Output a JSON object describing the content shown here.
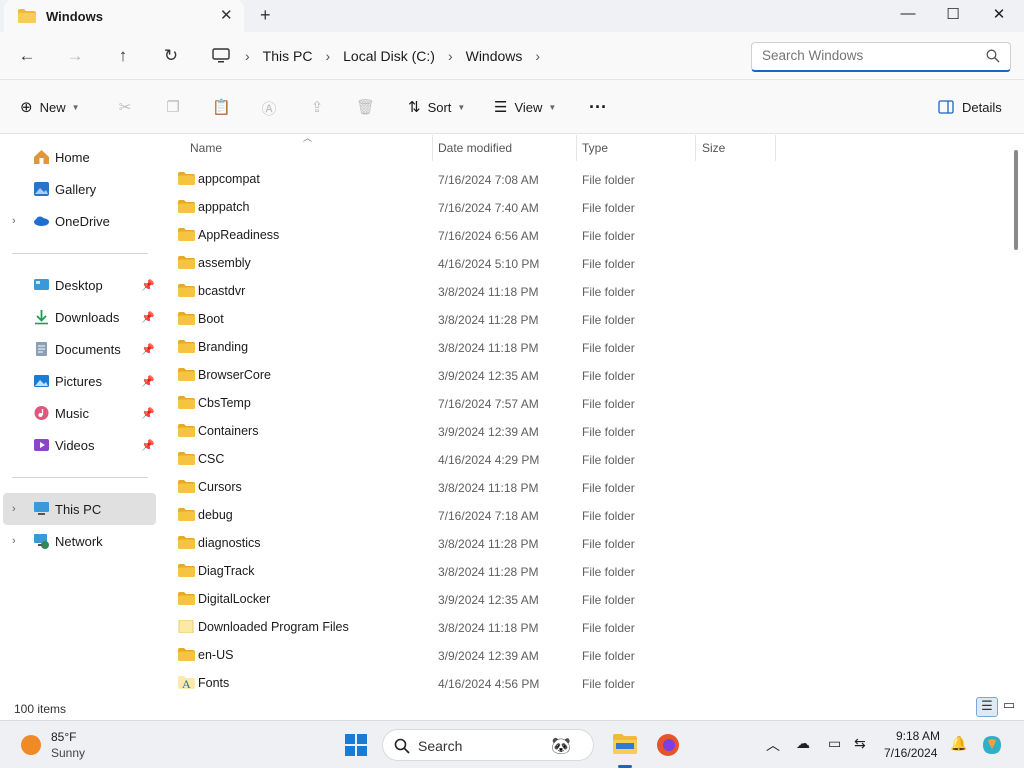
{
  "window": {
    "tab_title": "Windows",
    "new_tab": "+",
    "minimize": "—",
    "maximize": "☐",
    "close": "✕"
  },
  "nav": {
    "back": "←",
    "forward": "→",
    "up": "↑",
    "refresh": "↻",
    "breadcrumb": [
      "This PC",
      "Local Disk (C:)",
      "Windows"
    ],
    "search_placeholder": "Search Windows"
  },
  "toolbar": {
    "new_label": "New",
    "sort_label": "Sort",
    "view_label": "View",
    "more_label": "···",
    "details_label": "Details"
  },
  "sidebar": {
    "top": [
      {
        "label": "Home",
        "icon": "home-icon"
      },
      {
        "label": "Gallery",
        "icon": "gallery-icon"
      },
      {
        "label": "OneDrive",
        "icon": "onedrive-icon",
        "expandable": true
      }
    ],
    "quick": [
      {
        "label": "Desktop",
        "icon": "desktop-icon"
      },
      {
        "label": "Downloads",
        "icon": "downloads-icon"
      },
      {
        "label": "Documents",
        "icon": "documents-icon"
      },
      {
        "label": "Pictures",
        "icon": "pictures-icon"
      },
      {
        "label": "Music",
        "icon": "music-icon"
      },
      {
        "label": "Videos",
        "icon": "videos-icon"
      }
    ],
    "bottom": [
      {
        "label": "This PC",
        "icon": "this-pc-icon",
        "selected": true
      },
      {
        "label": "Network",
        "icon": "network-icon"
      }
    ]
  },
  "columns": {
    "name": "Name",
    "date": "Date modified",
    "type": "Type",
    "size": "Size"
  },
  "files": [
    {
      "name": "appcompat",
      "date": "7/16/2024 7:08 AM",
      "type": "File folder",
      "icon": "folder-icon"
    },
    {
      "name": "apppatch",
      "date": "7/16/2024 7:40 AM",
      "type": "File folder",
      "icon": "folder-icon"
    },
    {
      "name": "AppReadiness",
      "date": "7/16/2024 6:56 AM",
      "type": "File folder",
      "icon": "folder-icon"
    },
    {
      "name": "assembly",
      "date": "4/16/2024 5:10 PM",
      "type": "File folder",
      "icon": "folder-icon"
    },
    {
      "name": "bcastdvr",
      "date": "3/8/2024 11:18 PM",
      "type": "File folder",
      "icon": "folder-icon"
    },
    {
      "name": "Boot",
      "date": "3/8/2024 11:28 PM",
      "type": "File folder",
      "icon": "folder-icon"
    },
    {
      "name": "Branding",
      "date": "3/8/2024 11:18 PM",
      "type": "File folder",
      "icon": "folder-icon"
    },
    {
      "name": "BrowserCore",
      "date": "3/9/2024 12:35 AM",
      "type": "File folder",
      "icon": "folder-icon"
    },
    {
      "name": "CbsTemp",
      "date": "7/16/2024 7:57 AM",
      "type": "File folder",
      "icon": "folder-icon"
    },
    {
      "name": "Containers",
      "date": "3/9/2024 12:39 AM",
      "type": "File folder",
      "icon": "folder-icon"
    },
    {
      "name": "CSC",
      "date": "4/16/2024 4:29 PM",
      "type": "File folder",
      "icon": "folder-icon"
    },
    {
      "name": "Cursors",
      "date": "3/8/2024 11:18 PM",
      "type": "File folder",
      "icon": "folder-icon"
    },
    {
      "name": "debug",
      "date": "7/16/2024 7:18 AM",
      "type": "File folder",
      "icon": "folder-icon"
    },
    {
      "name": "diagnostics",
      "date": "3/8/2024 11:28 PM",
      "type": "File folder",
      "icon": "folder-icon"
    },
    {
      "name": "DiagTrack",
      "date": "3/8/2024 11:28 PM",
      "type": "File folder",
      "icon": "folder-icon"
    },
    {
      "name": "DigitalLocker",
      "date": "3/9/2024 12:35 AM",
      "type": "File folder",
      "icon": "folder-icon"
    },
    {
      "name": "Downloaded Program Files",
      "date": "3/8/2024 11:18 PM",
      "type": "File folder",
      "icon": "special-folder-icon"
    },
    {
      "name": "en-US",
      "date": "3/9/2024 12:39 AM",
      "type": "File folder",
      "icon": "folder-icon"
    },
    {
      "name": "Fonts",
      "date": "4/16/2024 4:56 PM",
      "type": "File folder",
      "icon": "fonts-folder-icon"
    }
  ],
  "status": {
    "item_count": "100 items"
  },
  "taskbar": {
    "temperature": "85°F",
    "condition": "Sunny",
    "search_label": "Search",
    "time": "9:18 AM",
    "date": "7/16/2024"
  },
  "colors": {
    "accent": "#1f63c4",
    "folder": "#f6c343",
    "folder_dark": "#e8a92b"
  }
}
